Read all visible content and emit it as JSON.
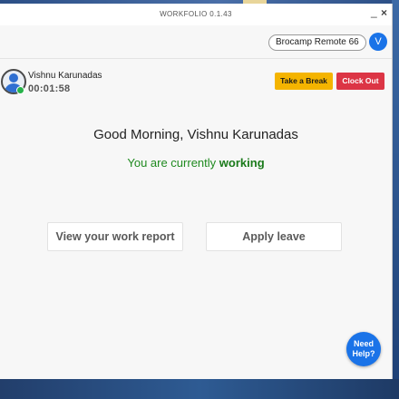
{
  "window": {
    "title": "WORKFOLIO 0.1.43",
    "minimize_glyph": "_",
    "close_glyph": "×"
  },
  "topbar": {
    "workspace": "Brocamp Remote 66",
    "user_initial": "V"
  },
  "user": {
    "name": "Vishnu Karunadas",
    "elapsed": "00:01:58",
    "status_color": "#27b24a"
  },
  "actions": {
    "break_label": "Take a Break",
    "clockout_label": "Clock Out"
  },
  "main": {
    "greeting": "Good Morning, Vishnu Karunadas",
    "status_prefix": "You are currently",
    "status_value": "working",
    "report_label": "View your work report",
    "leave_label": "Apply leave"
  },
  "help": {
    "line1": "Need",
    "line2": "Help?"
  },
  "colors": {
    "accent": "#1a73e8",
    "break": "#f4b400",
    "clockout": "#dc3545",
    "working": "#1f8a1f"
  }
}
